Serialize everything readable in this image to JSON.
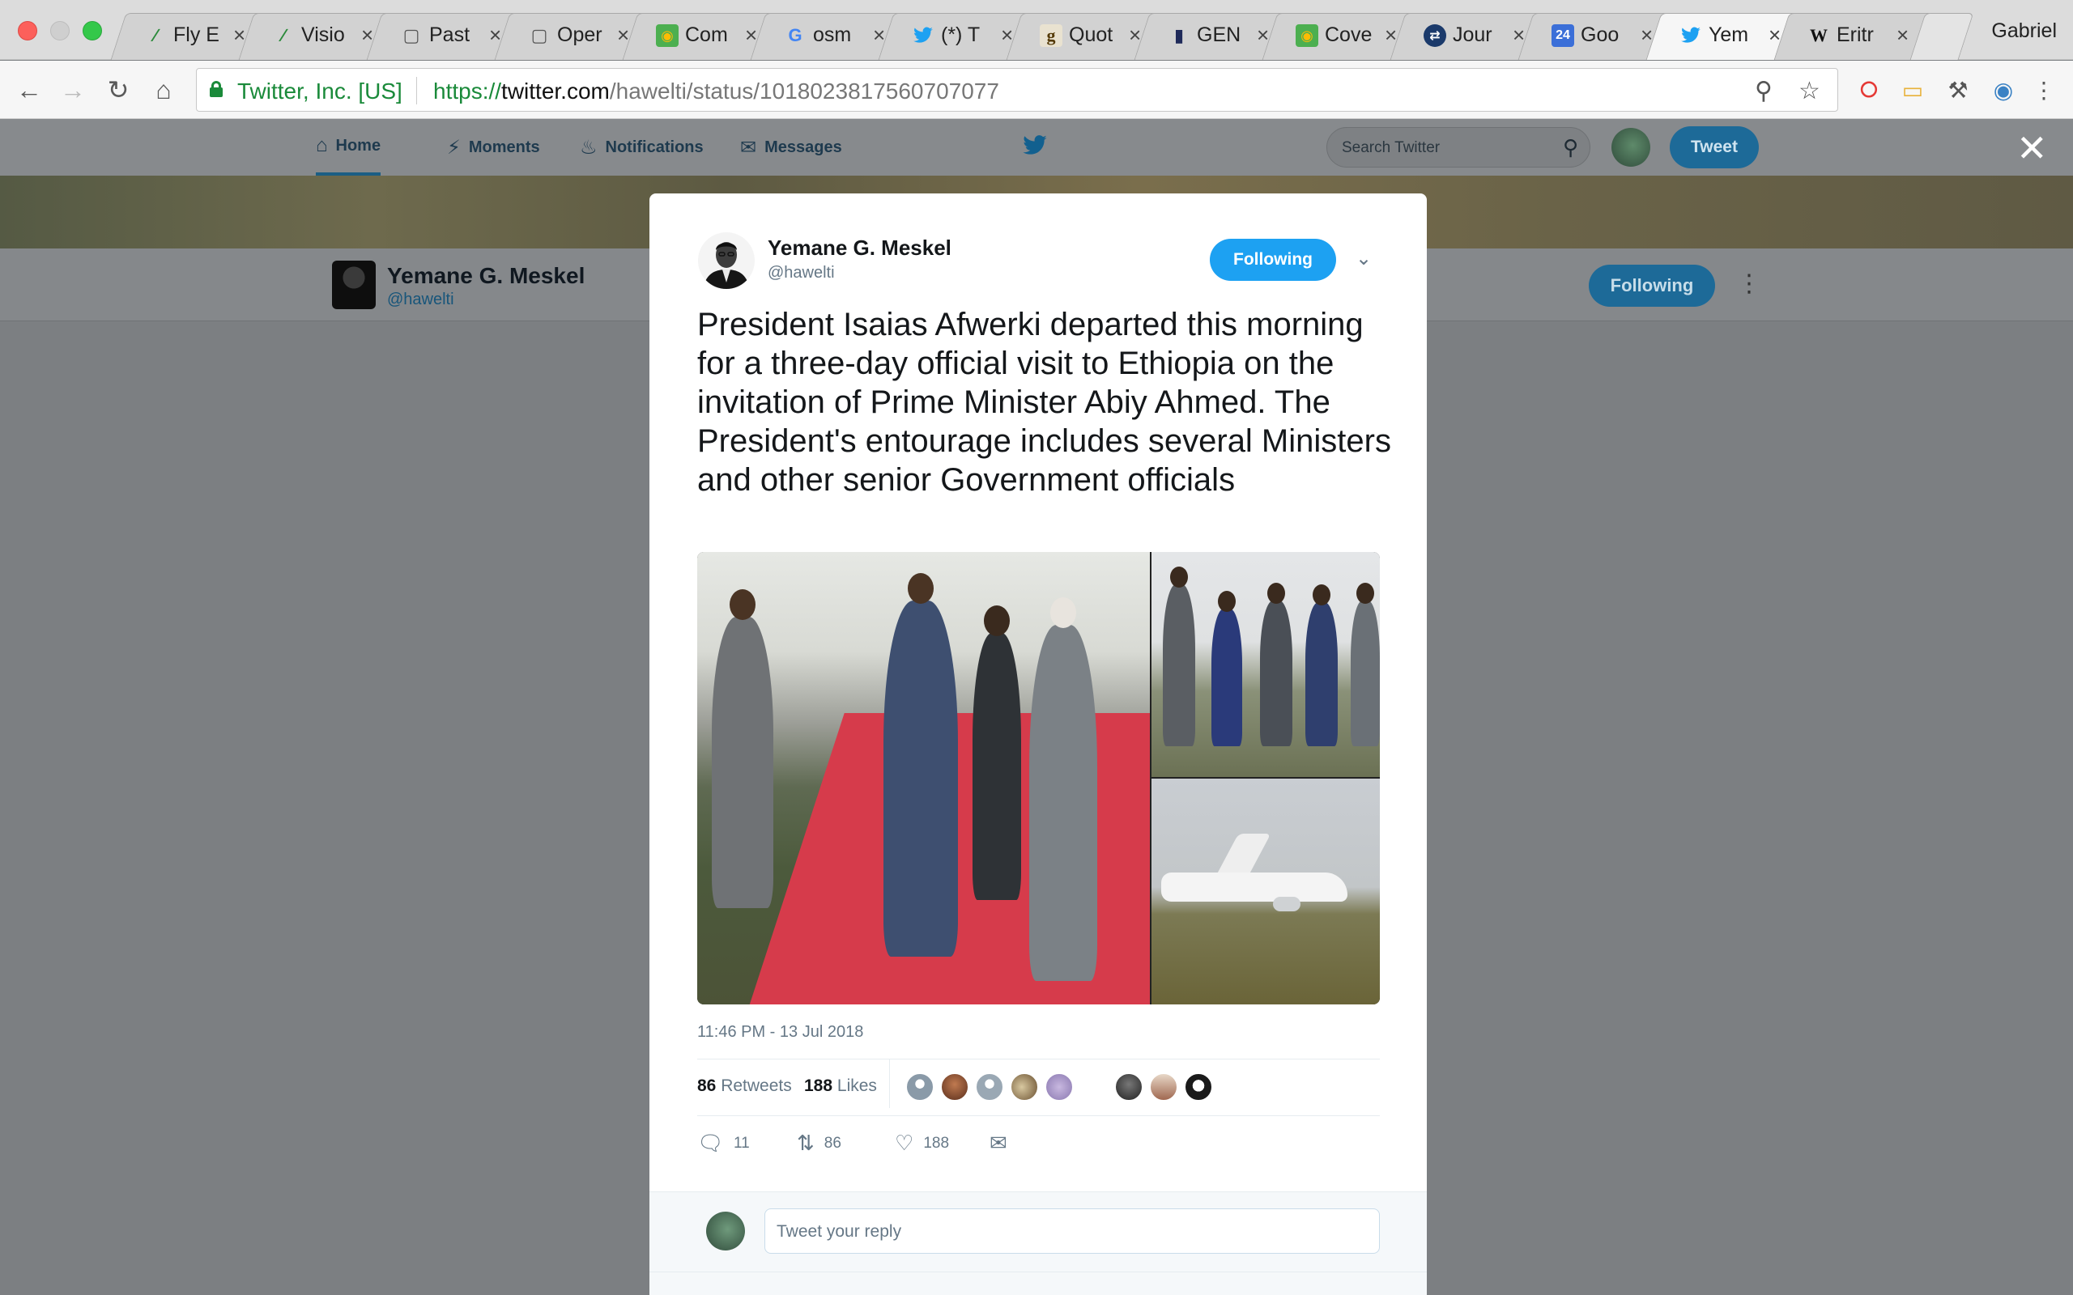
{
  "browser": {
    "tabs": [
      {
        "title": "Fly E",
        "favicon": "flag-icon"
      },
      {
        "title": "Visio",
        "favicon": "flag-icon"
      },
      {
        "title": "Past",
        "favicon": "document-icon"
      },
      {
        "title": "Oper",
        "favicon": "document-icon"
      },
      {
        "title": "Com",
        "favicon": "maps-icon"
      },
      {
        "title": "osm",
        "favicon": "google-icon"
      },
      {
        "title": "(*) T",
        "favicon": "twitter-icon"
      },
      {
        "title": "Quot",
        "favicon": "goodreads-icon"
      },
      {
        "title": "GEN",
        "favicon": "book-icon"
      },
      {
        "title": "Cove",
        "favicon": "maps-icon"
      },
      {
        "title": "Jour",
        "favicon": "journal-icon"
      },
      {
        "title": "Goo",
        "favicon": "calendar-icon",
        "favicon_text": "24"
      },
      {
        "title": "Yem",
        "favicon": "twitter-icon",
        "active": true
      },
      {
        "title": "Eritr",
        "favicon": "wikipedia-icon",
        "favicon_text": "W"
      }
    ],
    "user_name": "Gabriel",
    "site_identity": "Twitter, Inc. [US]",
    "url_scheme": "https://",
    "url_host": "twitter.com",
    "url_path": "/hawelti/status/1018023817560707077"
  },
  "twitter_nav": {
    "home": "Home",
    "moments": "Moments",
    "notifications": "Notifications",
    "messages": "Messages",
    "search_placeholder": "Search Twitter",
    "tweet_button": "Tweet"
  },
  "profile": {
    "name": "Yemane G. Meskel",
    "handle": "@hawelti",
    "follow_state": "Following"
  },
  "tweet": {
    "author_name": "Yemane G. Meskel",
    "author_handle": "@hawelti",
    "follow_state": "Following",
    "text": "President Isaias Afwerki departed this morning for a three-day official visit to Ethiopia on the invitation of Prime Minister Abiy Ahmed.  The President's entourage includes several Ministers and other senior Government officials",
    "timestamp": "11:46 PM - 13 Jul 2018",
    "retweets_count": "86",
    "retweets_label": "Retweets",
    "likes_count": "188",
    "likes_label": "Likes",
    "reply_count": "11",
    "retweet_count_action": "86",
    "like_count_action": "188",
    "reply_placeholder": "Tweet your reply"
  },
  "colors": {
    "twitter_blue": "#1da1f2",
    "secure_green": "#1a8a3a",
    "overlay_gray": "#7c7f82"
  }
}
